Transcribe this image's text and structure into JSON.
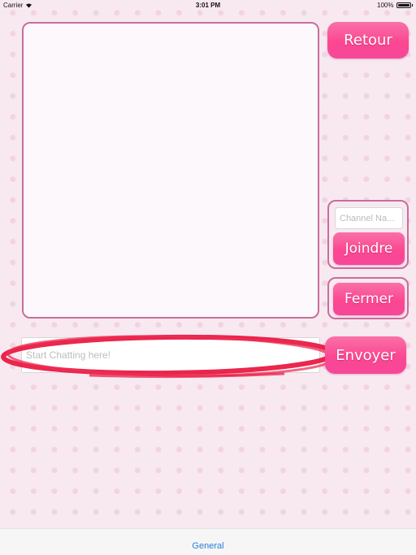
{
  "status_bar": {
    "carrier": "Carrier",
    "time": "3:01 PM",
    "battery": "100%",
    "battery_level": 1.0,
    "wifi_icon": "wifi-icon",
    "battery_icon": "battery-icon"
  },
  "buttons": {
    "back": "Retour",
    "join": "Joindre",
    "close": "Fermer",
    "send": "Envoyer"
  },
  "channel_input": {
    "placeholder": "Channel Na...",
    "value": ""
  },
  "message_input": {
    "placeholder": "Start Chatting here!",
    "value": ""
  },
  "tab_bar": {
    "tabs": [
      {
        "label": "General"
      }
    ]
  },
  "colors": {
    "accent_pink": "#fc4791",
    "frame_border": "#c86e9b",
    "annotation_red": "#e8103a",
    "tab_blue": "#2b7fd6"
  }
}
